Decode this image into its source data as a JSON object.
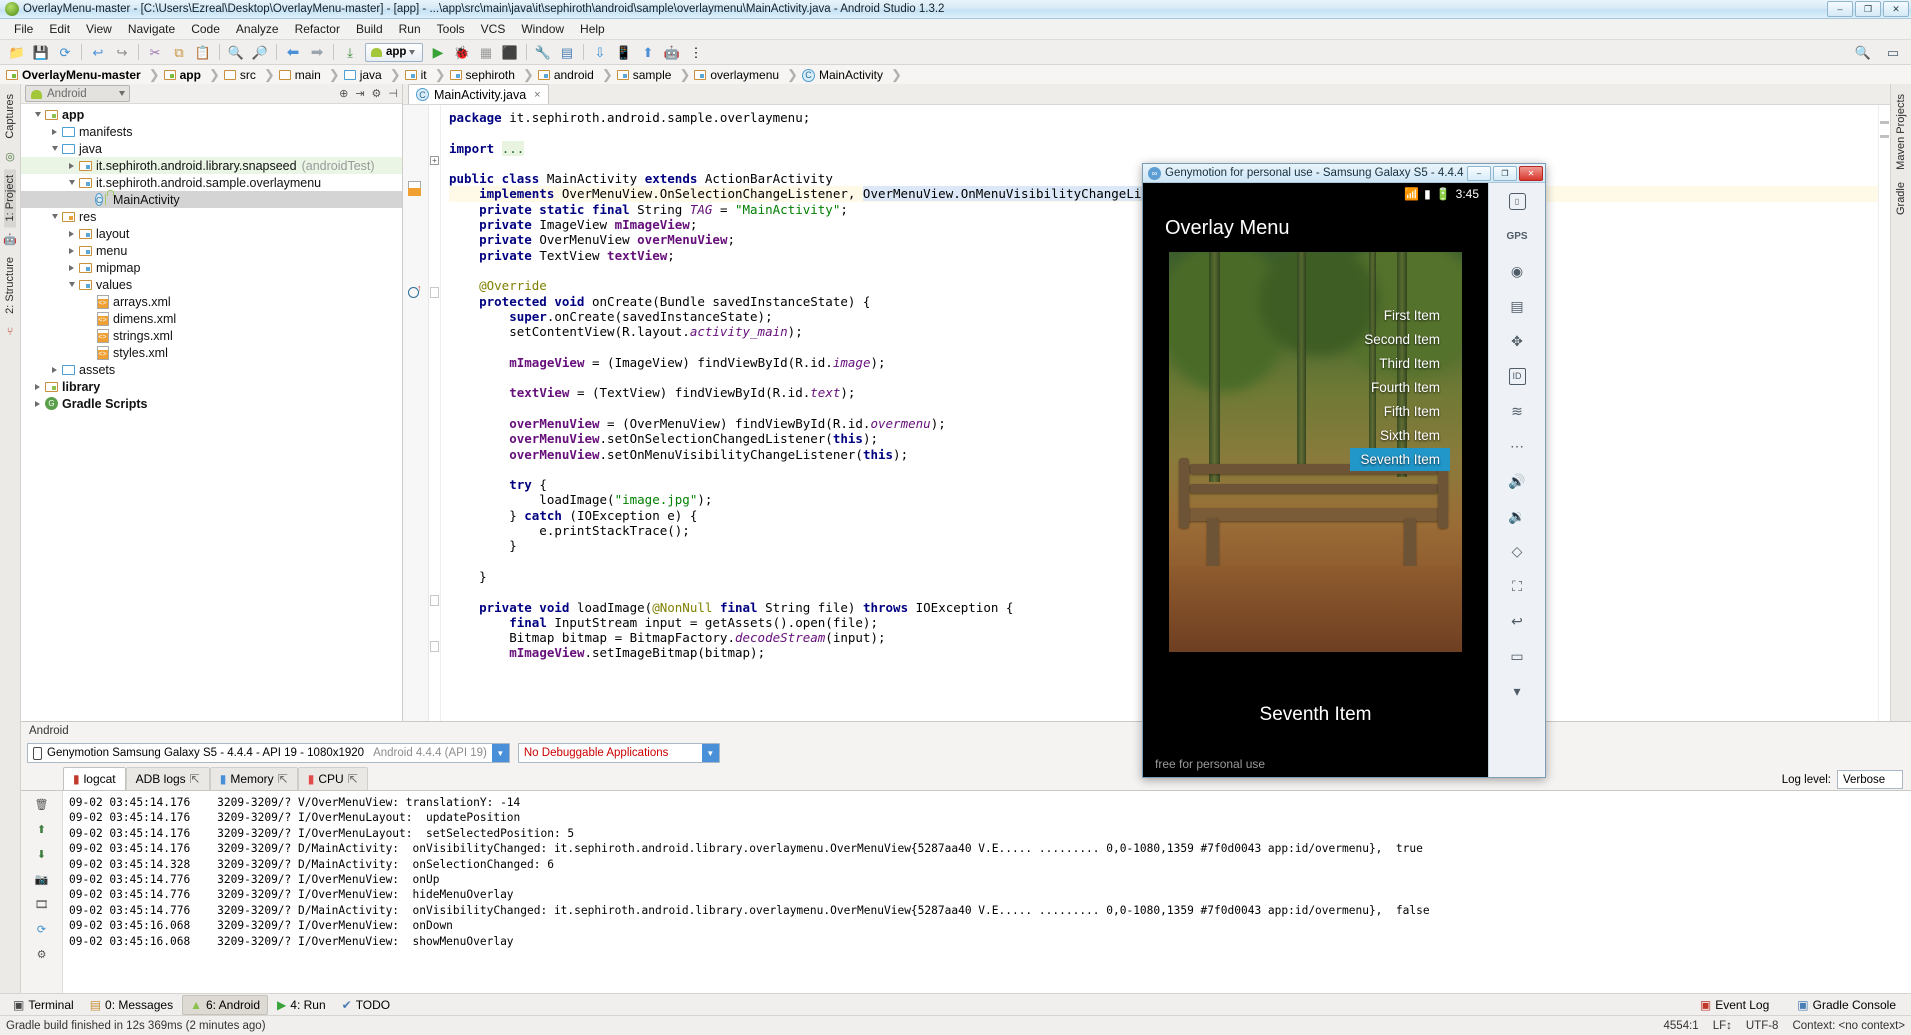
{
  "window": {
    "title": "OverlayMenu-master - [C:\\Users\\Ezreal\\Desktop\\OverlayMenu-master] - [app] - ...\\app\\src\\main\\java\\it\\sephiroth\\android\\sample\\overlaymenu\\MainActivity.java - Android Studio 1.3.2",
    "minimize": "–",
    "maximize": "❐",
    "close": "✕"
  },
  "menubar": [
    "File",
    "Edit",
    "View",
    "Navigate",
    "Code",
    "Analyze",
    "Refactor",
    "Build",
    "Run",
    "Tools",
    "VCS",
    "Window",
    "Help"
  ],
  "toolbar": {
    "icons": [
      "open-folder-icon",
      "save-all-icon",
      "sync-icon",
      "undo-icon",
      "redo-icon",
      "cut-icon",
      "copy-icon",
      "paste-icon",
      "find-icon",
      "replace-icon",
      "back-icon",
      "forward-icon",
      "compile-icon"
    ],
    "module_selector": "app",
    "run_icon": "run-icon",
    "debug_icon": "debug-icon",
    "coverage_icon": "coverage-icon",
    "attach_icon": "attach-debugger-icon",
    "sdk_icon": "sdk-manager-icon",
    "avd_icon": "avd-manager-icon",
    "search_icon": "search-everywhere-icon"
  },
  "breadcrumbs": [
    {
      "label": "OverlayMenu-master",
      "icon": "project-folder-icon",
      "bold": true
    },
    {
      "label": "app",
      "icon": "module-folder-icon",
      "bold": true
    },
    {
      "label": "src",
      "icon": "folder-icon",
      "bold": false
    },
    {
      "label": "main",
      "icon": "folder-icon",
      "bold": false
    },
    {
      "label": "java",
      "icon": "java-folder-icon",
      "bold": false
    },
    {
      "label": "it",
      "icon": "package-icon",
      "bold": false
    },
    {
      "label": "sephiroth",
      "icon": "package-icon",
      "bold": false
    },
    {
      "label": "android",
      "icon": "package-icon",
      "bold": false
    },
    {
      "label": "sample",
      "icon": "package-icon",
      "bold": false
    },
    {
      "label": "overlaymenu",
      "icon": "package-icon",
      "bold": false
    },
    {
      "label": "MainActivity",
      "icon": "class-icon",
      "bold": false
    }
  ],
  "left_rail": {
    "items": [
      "Captures",
      "1: Project",
      "2: Structure"
    ],
    "selected": "1: Project",
    "icons": [
      "captures-icon",
      "android-icon",
      "variants-icon"
    ]
  },
  "project_panel": {
    "view_selector": "Android",
    "header_icons": [
      "target-icon",
      "collapse-icon",
      "settings-gear-icon",
      "hide-icon"
    ],
    "tree": [
      {
        "label": "app",
        "indent": 0,
        "arrow": "down",
        "icon": "module-folder-icon",
        "bold": true,
        "state": "normal"
      },
      {
        "label": "manifests",
        "indent": 1,
        "arrow": "right",
        "icon": "folder-blue-icon",
        "bold": false,
        "state": "normal"
      },
      {
        "label": "java",
        "indent": 1,
        "arrow": "down",
        "icon": "folder-blue-icon",
        "bold": false,
        "state": "normal"
      },
      {
        "label": "it.sephiroth.android.library.snapseed",
        "suffix": "(androidTest)",
        "indent": 2,
        "arrow": "right",
        "icon": "package-icon",
        "bold": false,
        "state": "green"
      },
      {
        "label": "it.sephiroth.android.sample.overlaymenu",
        "indent": 2,
        "arrow": "down",
        "icon": "package-icon",
        "bold": false,
        "state": "normal"
      },
      {
        "label": "MainActivity",
        "indent": 3,
        "arrow": "none",
        "icon": "class-icon",
        "bold": false,
        "state": "selected"
      },
      {
        "label": "res",
        "indent": 1,
        "arrow": "down",
        "icon": "res-folder-icon",
        "bold": false,
        "state": "normal"
      },
      {
        "label": "layout",
        "indent": 2,
        "arrow": "right",
        "icon": "package-icon",
        "bold": false,
        "state": "normal"
      },
      {
        "label": "menu",
        "indent": 2,
        "arrow": "right",
        "icon": "package-icon",
        "bold": false,
        "state": "normal"
      },
      {
        "label": "mipmap",
        "indent": 2,
        "arrow": "right",
        "icon": "package-icon",
        "bold": false,
        "state": "normal"
      },
      {
        "label": "values",
        "indent": 2,
        "arrow": "down",
        "icon": "package-icon",
        "bold": false,
        "state": "normal"
      },
      {
        "label": "arrays.xml",
        "indent": 3,
        "arrow": "none",
        "icon": "xml-file-icon",
        "bold": false,
        "state": "normal"
      },
      {
        "label": "dimens.xml",
        "indent": 3,
        "arrow": "none",
        "icon": "xml-file-icon",
        "bold": false,
        "state": "normal"
      },
      {
        "label": "strings.xml",
        "indent": 3,
        "arrow": "none",
        "icon": "xml-file-icon",
        "bold": false,
        "state": "normal"
      },
      {
        "label": "styles.xml",
        "indent": 3,
        "arrow": "none",
        "icon": "xml-file-icon",
        "bold": false,
        "state": "normal"
      },
      {
        "label": "assets",
        "indent": 1,
        "arrow": "right",
        "icon": "folder-blue-icon",
        "bold": false,
        "state": "normal"
      },
      {
        "label": "library",
        "indent": 0,
        "arrow": "right",
        "icon": "module-folder-icon",
        "bold": true,
        "state": "normal"
      },
      {
        "label": "Gradle Scripts",
        "indent": 0,
        "arrow": "right",
        "icon": "gradle-icon",
        "bold": true,
        "state": "normal"
      }
    ]
  },
  "editor": {
    "tab": {
      "label": "MainActivity.java",
      "icon": "class-icon",
      "close": "×"
    },
    "code_lines": [
      [
        {
          "t": "package ",
          "c": "kw"
        },
        {
          "t": "it.sephiroth.android.sample.overlaymenu;",
          "c": ""
        }
      ],
      [],
      [
        {
          "t": "import ",
          "c": "kw"
        },
        {
          "t": "...",
          "c": "fold"
        }
      ],
      [],
      [
        {
          "t": "public class ",
          "c": "kw"
        },
        {
          "t": "MainActivity ",
          "c": ""
        },
        {
          "t": "extends ",
          "c": "kw"
        },
        {
          "t": "ActionBarActivity",
          "c": ""
        }
      ],
      [
        {
          "t": "    implements ",
          "c": "kw"
        },
        {
          "t": "OverMenuView.OnSelectionChangeListener, ",
          "c": ""
        },
        {
          "t": "OverMenuView.OnMenuVisibilityChangeListener",
          "c": "sel"
        },
        {
          "t": " {",
          "c": ""
        }
      ],
      [
        {
          "t": "    private static final ",
          "c": "kw"
        },
        {
          "t": "String ",
          "c": ""
        },
        {
          "t": "TAG",
          "c": "stat"
        },
        {
          "t": " = ",
          "c": ""
        },
        {
          "t": "\"MainActivity\"",
          "c": "str"
        },
        {
          "t": ";",
          "c": ""
        }
      ],
      [
        {
          "t": "    private ",
          "c": "kw"
        },
        {
          "t": "ImageView ",
          "c": ""
        },
        {
          "t": "mImageView",
          "c": "fld2"
        },
        {
          "t": ";",
          "c": ""
        }
      ],
      [
        {
          "t": "    private ",
          "c": "kw"
        },
        {
          "t": "OverMenuView ",
          "c": ""
        },
        {
          "t": "overMenuView",
          "c": "fld2"
        },
        {
          "t": ";",
          "c": ""
        }
      ],
      [
        {
          "t": "    private ",
          "c": "kw"
        },
        {
          "t": "TextView ",
          "c": ""
        },
        {
          "t": "textView",
          "c": "fld2"
        },
        {
          "t": ";",
          "c": ""
        }
      ],
      [],
      [
        {
          "t": "    @Override",
          "c": "ann"
        }
      ],
      [
        {
          "t": "    protected void ",
          "c": "kw"
        },
        {
          "t": "onCreate(Bundle savedInstanceState) {",
          "c": ""
        }
      ],
      [
        {
          "t": "        super",
          "c": "kw"
        },
        {
          "t": ".onCreate(savedInstanceState);",
          "c": ""
        }
      ],
      [
        {
          "t": "        setContentView(R.layout.",
          "c": ""
        },
        {
          "t": "activity_main",
          "c": "stat"
        },
        {
          "t": ");",
          "c": ""
        }
      ],
      [],
      [
        {
          "t": "        ",
          "c": ""
        },
        {
          "t": "mImageView",
          "c": "fld2"
        },
        {
          "t": " = (ImageView) findViewById(R.id.",
          "c": ""
        },
        {
          "t": "image",
          "c": "stat"
        },
        {
          "t": ");",
          "c": ""
        }
      ],
      [],
      [
        {
          "t": "        ",
          "c": ""
        },
        {
          "t": "textView",
          "c": "fld2"
        },
        {
          "t": " = (TextView) findViewById(R.id.",
          "c": ""
        },
        {
          "t": "text",
          "c": "stat"
        },
        {
          "t": ");",
          "c": ""
        }
      ],
      [],
      [
        {
          "t": "        ",
          "c": ""
        },
        {
          "t": "overMenuView",
          "c": "fld2"
        },
        {
          "t": " = (OverMenuView) findViewById(R.id.",
          "c": ""
        },
        {
          "t": "overmenu",
          "c": "stat"
        },
        {
          "t": ");",
          "c": ""
        }
      ],
      [
        {
          "t": "        ",
          "c": ""
        },
        {
          "t": "overMenuView",
          "c": "fld2"
        },
        {
          "t": ".setOnSelectionChangedListener(",
          "c": ""
        },
        {
          "t": "this",
          "c": "kw"
        },
        {
          "t": ");",
          "c": ""
        }
      ],
      [
        {
          "t": "        ",
          "c": ""
        },
        {
          "t": "overMenuView",
          "c": "fld2"
        },
        {
          "t": ".setOnMenuVisibilityChangeListener(",
          "c": ""
        },
        {
          "t": "this",
          "c": "kw"
        },
        {
          "t": ");",
          "c": ""
        }
      ],
      [],
      [
        {
          "t": "        try ",
          "c": "kw"
        },
        {
          "t": "{",
          "c": ""
        }
      ],
      [
        {
          "t": "            loadImage(",
          "c": ""
        },
        {
          "t": "\"image.jpg\"",
          "c": "str"
        },
        {
          "t": ");",
          "c": ""
        }
      ],
      [
        {
          "t": "        } ",
          "c": ""
        },
        {
          "t": "catch ",
          "c": "kw"
        },
        {
          "t": "(IOException e) {",
          "c": ""
        }
      ],
      [
        {
          "t": "            e.printStackTrace();",
          "c": ""
        }
      ],
      [
        {
          "t": "        }",
          "c": ""
        }
      ],
      [],
      [
        {
          "t": "    }",
          "c": ""
        }
      ],
      [],
      [
        {
          "t": "    private void ",
          "c": "kw"
        },
        {
          "t": "loadImage(",
          "c": ""
        },
        {
          "t": "@NonNull ",
          "c": "ann"
        },
        {
          "t": "final ",
          "c": "kw"
        },
        {
          "t": "String file) ",
          "c": ""
        },
        {
          "t": "throws ",
          "c": "kw"
        },
        {
          "t": "IOException {",
          "c": ""
        }
      ],
      [
        {
          "t": "        ",
          "c": ""
        },
        {
          "t": "final ",
          "c": "kw"
        },
        {
          "t": "InputStream input = getAssets().open(file);",
          "c": ""
        }
      ],
      [
        {
          "t": "        Bitmap bitmap = BitmapFactory.",
          "c": ""
        },
        {
          "t": "decodeStream",
          "c": "stat"
        },
        {
          "t": "(input);",
          "c": ""
        }
      ],
      [
        {
          "t": "        ",
          "c": ""
        },
        {
          "t": "mImageView",
          "c": "fld2"
        },
        {
          "t": ".setImageBitmap(bitmap);",
          "c": ""
        }
      ]
    ]
  },
  "right_rail": {
    "items": [
      "Maven Projects",
      "Gradle"
    ]
  },
  "bottom_panel": {
    "title": "Android",
    "device": "Genymotion Samsung Galaxy S5 - 4.4.4 - API 19 - 1080x1920",
    "device_suffix": "Android 4.4.4 (API 19)",
    "app_selector": "No Debuggable Applications",
    "tabs": [
      {
        "label": "logcat",
        "icon": "logcat-icon",
        "active": true,
        "detach": false
      },
      {
        "label": "ADB logs",
        "icon": "",
        "active": false,
        "detach": true
      },
      {
        "label": "Memory",
        "icon": "memory-icon",
        "active": false,
        "detach": true
      },
      {
        "label": "CPU",
        "icon": "cpu-icon",
        "active": false,
        "detach": true
      }
    ],
    "log_level_label": "Log level:",
    "log_level": "Verbose",
    "side_icons": [
      "trash-icon",
      "screenshot-icon",
      "video-icon",
      "gc-icon",
      "dump-icon",
      "restart-icon",
      "settings-icon"
    ],
    "log_lines": [
      "09-02 03:45:14.176    3209-3209/? V/OverMenuView: translationY: -14",
      "09-02 03:45:14.176    3209-3209/? I/OverMenuLayout:  updatePosition",
      "09-02 03:45:14.176    3209-3209/? I/OverMenuLayout:  setSelectedPosition: 5",
      "09-02 03:45:14.176    3209-3209/? D/MainActivity:  onVisibilityChanged: it.sephiroth.android.library.overlaymenu.OverMenuView{5287aa40 V.E..... ......... 0,0-1080,1359 #7f0d0043 app:id/overmenu},  true",
      "09-02 03:45:14.328    3209-3209/? D/MainActivity:  onSelectionChanged: 6",
      "09-02 03:45:14.776    3209-3209/? I/OverMenuView:  onUp",
      "09-02 03:45:14.776    3209-3209/? I/OverMenuView:  hideMenuOverlay",
      "09-02 03:45:14.776    3209-3209/? D/MainActivity:  onVisibilityChanged: it.sephiroth.android.library.overlaymenu.OverMenuView{5287aa40 V.E..... ......... 0,0-1080,1359 #7f0d0043 app:id/overmenu},  false",
      "09-02 03:45:16.068    3209-3209/? I/OverMenuView:  onDown",
      "09-02 03:45:16.068    3209-3209/? I/OverMenuView:  showMenuOverlay"
    ]
  },
  "tool_windows": {
    "left": [
      {
        "label": "Terminal",
        "icon": "terminal-icon",
        "active": false
      },
      {
        "label": "0: Messages",
        "icon": "messages-icon",
        "active": false
      },
      {
        "label": "6: Android",
        "icon": "android-icon",
        "active": true
      },
      {
        "label": "4: Run",
        "icon": "run-icon",
        "active": false
      },
      {
        "label": "TODO",
        "icon": "todo-icon",
        "active": false
      }
    ],
    "right": [
      {
        "label": "Event Log",
        "icon": "event-log-icon"
      },
      {
        "label": "Gradle Console",
        "icon": "gradle-console-icon"
      }
    ]
  },
  "statusbar": {
    "message": "Gradle build finished in 12s 369ms (2 minutes ago)",
    "caret": "4554:1",
    "line_sep": "LF↕",
    "encoding": "UTF-8",
    "context": "Context: <no context>"
  },
  "genymotion": {
    "title": "Genymotion for personal use - Samsung Galaxy S5 - 4.4.4 ...",
    "minimize": "–",
    "maximize": "❐",
    "close": "✕",
    "status_time": "3:45",
    "status_icons": [
      "wifi-icon",
      "signal-icon",
      "battery-icon"
    ],
    "app_title": "Overlay Menu",
    "bottom_title": "Seventh Item",
    "watermark": "free for personal use",
    "menu_items": [
      {
        "label": "First Item",
        "selected": false
      },
      {
        "label": "Second Item",
        "selected": false
      },
      {
        "label": "Third Item",
        "selected": false
      },
      {
        "label": "Fourth Item",
        "selected": false
      },
      {
        "label": "Fifth Item",
        "selected": false
      },
      {
        "label": "Sixth Item",
        "selected": false
      },
      {
        "label": "Seventh Item",
        "selected": true
      }
    ],
    "selection_color": "#2196c9",
    "side_tools": [
      "phone-icon",
      "gps-icon",
      "camera-icon",
      "battery-tool-icon",
      "network-icon",
      "id-icon",
      "signal-tool-icon",
      "more-icon",
      "volume-up-icon",
      "volume-down-icon",
      "rotate-icon",
      "fullscreen-icon",
      "back-icon",
      "recents-icon",
      "down-icon"
    ]
  }
}
